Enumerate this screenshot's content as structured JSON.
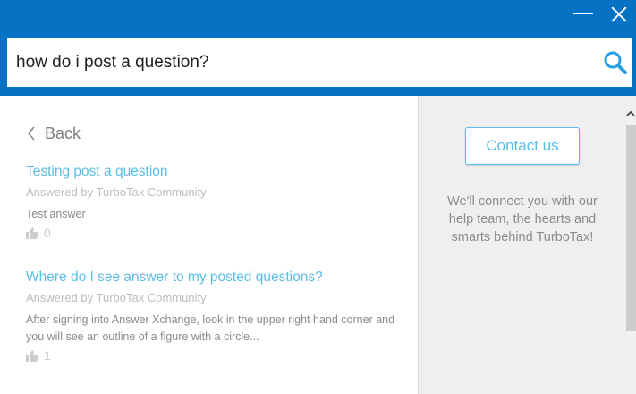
{
  "window": {
    "minimize_icon": "minimize-icon",
    "close_icon": "close-icon",
    "brand_color": "#0672c4"
  },
  "search": {
    "value": "how do i post a question?",
    "icon": "search-icon"
  },
  "back": {
    "label": "Back",
    "icon": "chevron-left-icon"
  },
  "results": [
    {
      "title": "Testing post a question",
      "meta": "Answered by TurboTax Community",
      "body": "Test answer",
      "likes": "0"
    },
    {
      "title": "Where do I see answer to my posted questions?",
      "meta": "Answered by TurboTax Community",
      "body": "After signing into Answer Xchange, look in the upper right hand corner and you will see an outline of a figure with a circle...",
      "likes": "1"
    }
  ],
  "contact": {
    "button_label": "Contact us",
    "description": "We'll connect you with our help team, the hearts and smarts behind TurboTax!"
  },
  "colors": {
    "link": "#5bbce8",
    "panel_bg": "#efefef"
  }
}
